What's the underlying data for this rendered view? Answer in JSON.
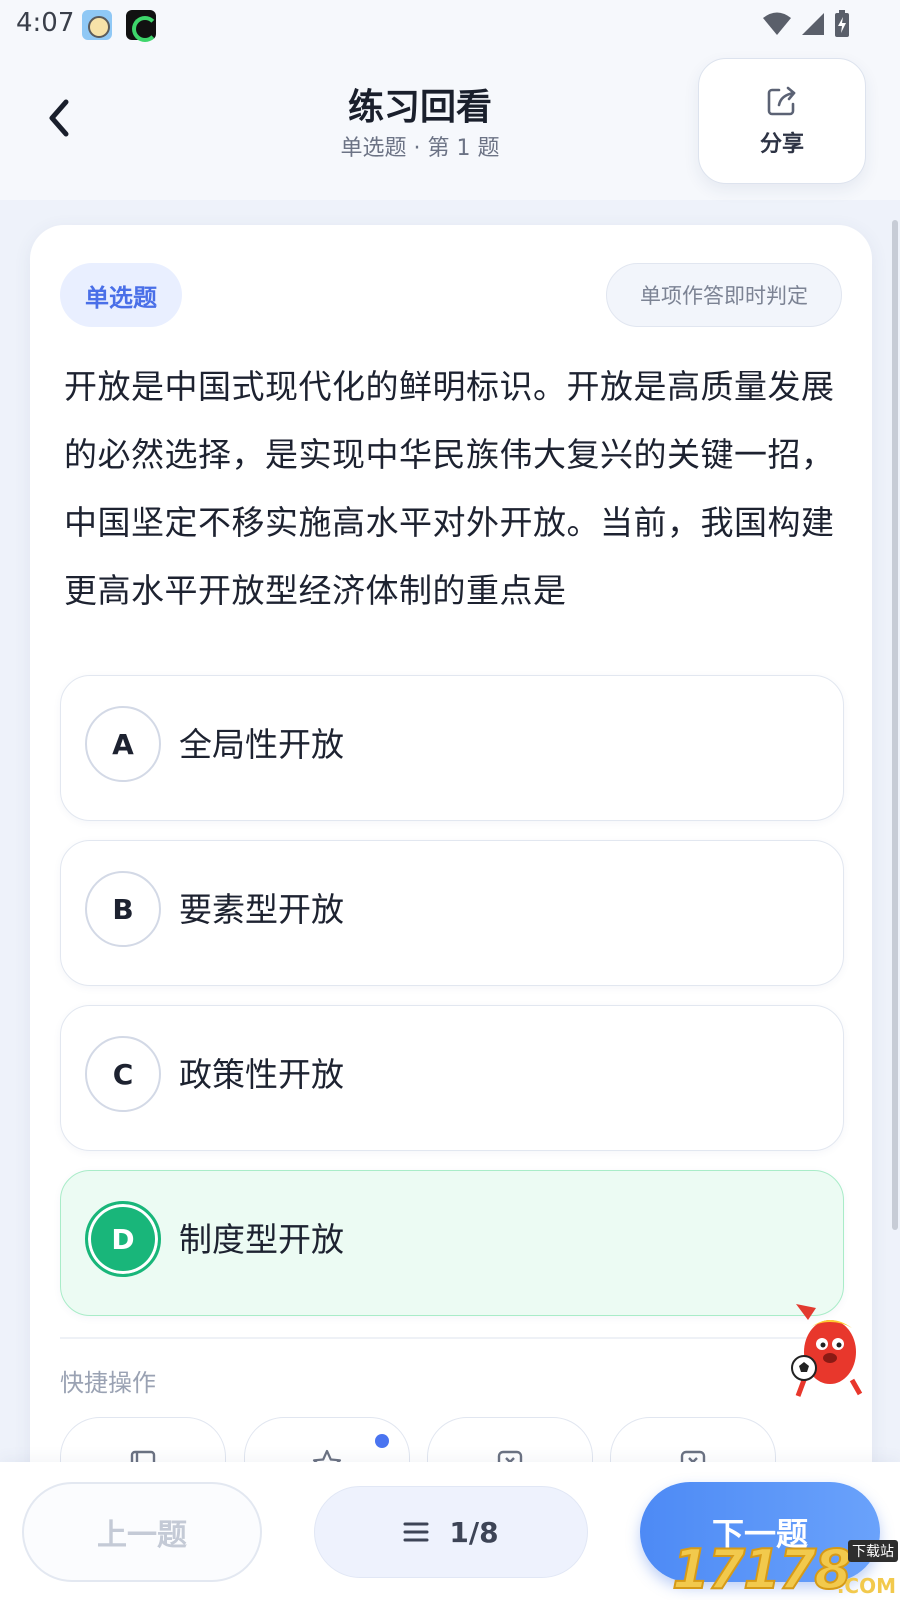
{
  "status_bar": {
    "time": "4:07"
  },
  "header": {
    "title": "练习回看",
    "subtitle": "单选题 · 第 1 题",
    "share_label": "分享"
  },
  "question": {
    "type_badge": "单选题",
    "mode_badge": "单项作答即时判定",
    "text": "开放是中国式现代化的鲜明标识。开放是高质量发展的必然选择，是实现中华民族伟大复兴的关键一招，中国坚定不移实施高水平对外开放。当前，我国构建更高水平开放型经济体制的重点是",
    "options": [
      {
        "letter": "A",
        "text": "全局性开放"
      },
      {
        "letter": "B",
        "text": "要素型开放"
      },
      {
        "letter": "C",
        "text": "政策性开放"
      },
      {
        "letter": "D",
        "text": "制度型开放"
      }
    ],
    "correct_option": "D"
  },
  "quick_actions": {
    "title": "快捷操作"
  },
  "bottom_bar": {
    "prev_label": "上一题",
    "progress_label": "1/8",
    "next_label": "下一题"
  },
  "watermark": {
    "number": "17178",
    "tag": "下载站",
    "suffix": ".COM"
  },
  "colors": {
    "accent": "#4a74f0",
    "correct": "#19b67a",
    "correct_bg": "#ecfbf3"
  }
}
